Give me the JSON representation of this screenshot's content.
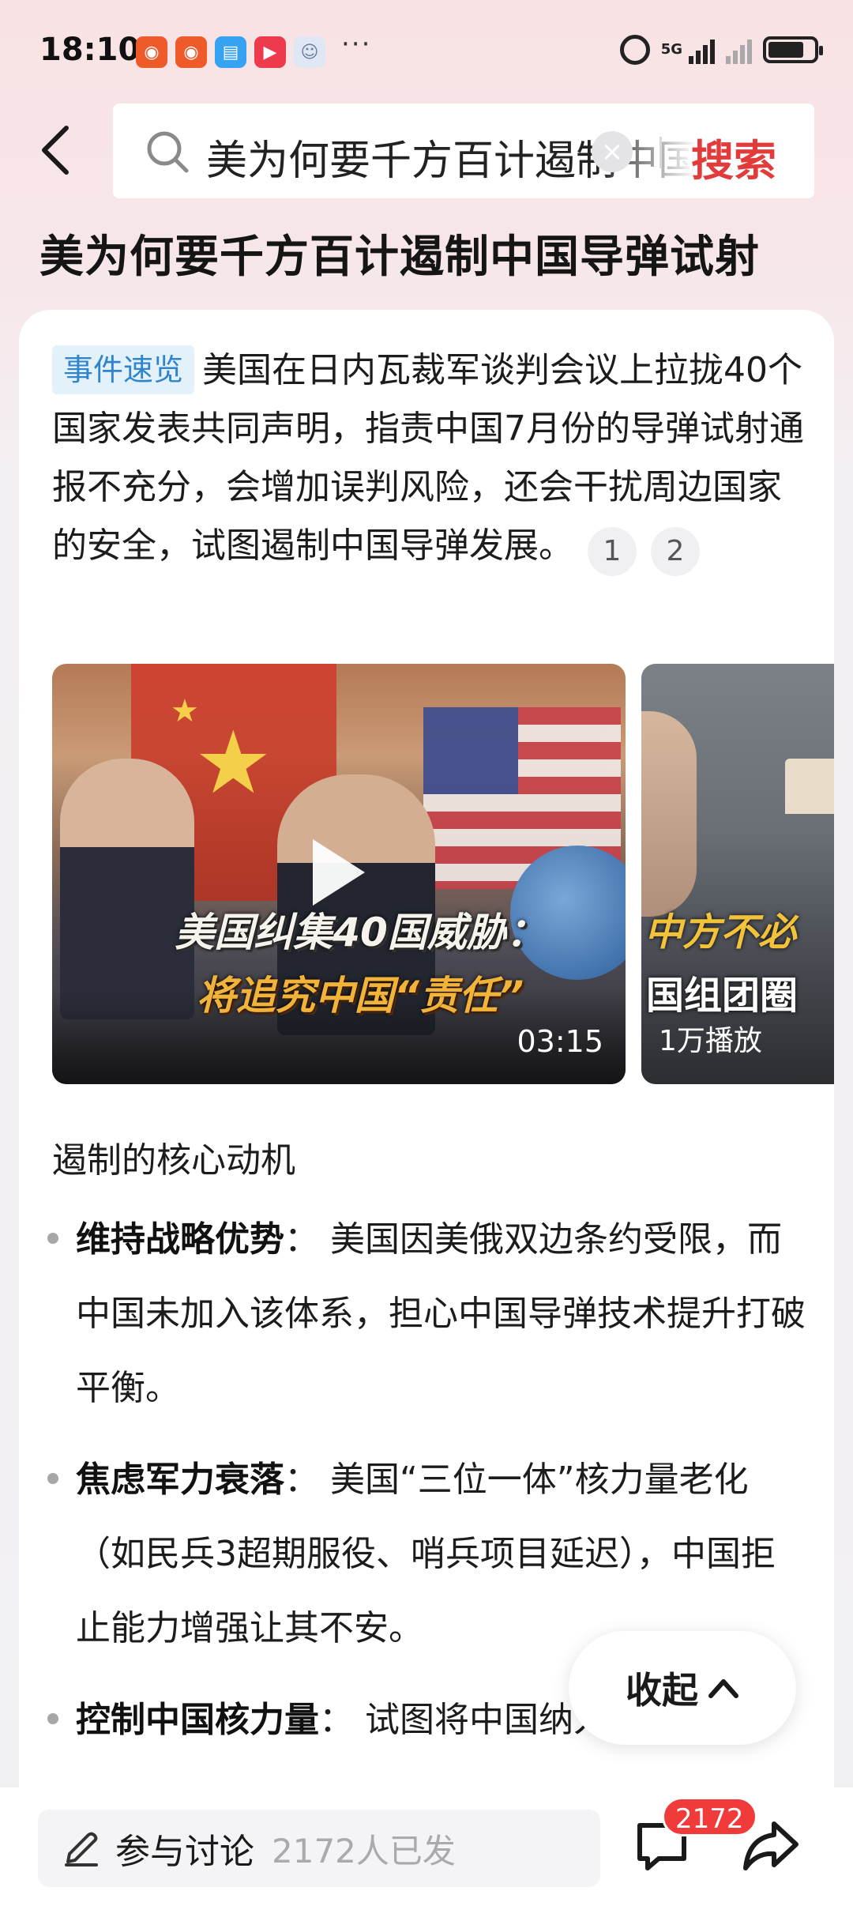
{
  "status_bar": {
    "time": "18:10",
    "more": "···",
    "network": "5G"
  },
  "header": {
    "search_query": "美为何要千方百计遏制中国导弹试射",
    "search_button": "搜索",
    "clear_symbol": "×"
  },
  "page_title": "美为何要千方百计遏制中国导弹试射",
  "summary": {
    "tag": "事件速览",
    "text": "美国在日内瓦裁军谈判会议上拉拢40个国家发表共同声明，指责中国7月份的导弹试射通报不充分，会增加误判风险，还会干扰周边国家的安全，试图遏制中国导弹发展。",
    "citations": [
      "1",
      "2"
    ]
  },
  "videos": [
    {
      "headline": "美国纠集40国威胁：",
      "subline": "将追究中国“责任”",
      "duration": "03:15"
    },
    {
      "headline": "中方不必",
      "subline": "国组团圈",
      "play_count": "1万播放"
    }
  ],
  "section": {
    "heading": "遏制的核心动机",
    "bullets": [
      {
        "title": "维持战略优势",
        "sep": "：",
        "text": "美国因美俄双边条约受限，而中国未加入该体系，担心中国导弹技术提升打破平衡。"
      },
      {
        "title": "焦虑军力衰落",
        "sep": "：",
        "text": "美国“三位一体”核力量老化（如民兵3超期服役、哨兵项目延迟），中国拒止能力增强让其不安。"
      },
      {
        "title": "控制中国核力量",
        "sep": "：",
        "text": "试图将中国纳入美俄式"
      }
    ]
  },
  "collapse_button": "收起",
  "bottom_bar": {
    "discuss_label": "参与讨论",
    "discuss_count": "2172人已发",
    "comment_badge": "2172"
  },
  "colors": {
    "accent_red": "#e23b3b",
    "tag_blue": "#2f84cc",
    "badge_red": "#f13a3a"
  },
  "icons": [
    "back-arrow-icon",
    "search-icon",
    "clear-icon",
    "pen-icon",
    "comment-icon",
    "share-icon",
    "chevron-up-icon",
    "play-icon"
  ]
}
